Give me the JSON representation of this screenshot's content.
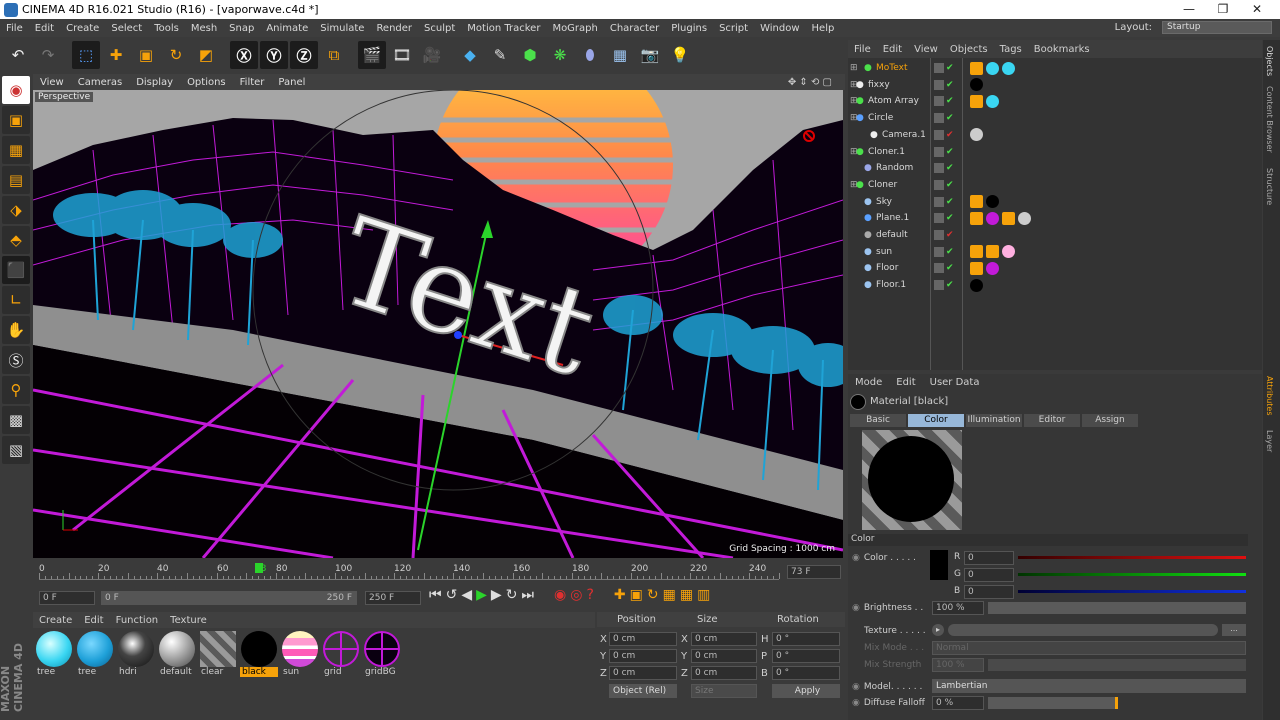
{
  "window": {
    "title": "CINEMA 4D R16.021 Studio (R16) - [vaporwave.c4d *]",
    "minimize": "—",
    "restore": "❐",
    "close": "✕"
  },
  "menu": [
    "File",
    "Edit",
    "Create",
    "Select",
    "Tools",
    "Mesh",
    "Snap",
    "Animate",
    "Simulate",
    "Render",
    "Sculpt",
    "Motion Tracker",
    "MoGraph",
    "Character",
    "Plugins",
    "Script",
    "Window",
    "Help"
  ],
  "layout": {
    "label": "Layout:",
    "value": "Startup"
  },
  "viewport": {
    "menu": [
      "View",
      "Cameras",
      "Display",
      "Options",
      "Filter",
      "Panel"
    ],
    "label": "Perspective",
    "grid": "Grid Spacing : 1000 cm",
    "text3d": "Text"
  },
  "timeline": {
    "ticks": [
      "0",
      "20",
      "40",
      "60",
      "73",
      "80",
      "100",
      "120",
      "140",
      "160",
      "180",
      "200",
      "220",
      "240"
    ],
    "current": "73 F"
  },
  "transport": {
    "start": "0 F",
    "range_start": "0 F",
    "range_end": "250 F",
    "end": "250 F"
  },
  "materials": {
    "menu": [
      "Create",
      "Edit",
      "Function",
      "Texture"
    ],
    "items": [
      "tree",
      "tree",
      "hdri",
      "default",
      "clear",
      "black",
      "sun",
      "grid",
      "gridBG"
    ],
    "brand": "MAXON CINEMA 4D"
  },
  "coords": {
    "headers": [
      "Position",
      "Size",
      "Rotation"
    ],
    "x": "0 cm",
    "y": "0 cm",
    "z": "0 cm",
    "sx": "0 cm",
    "sy": "0 cm",
    "sz": "0 cm",
    "h": "0 °",
    "p": "0 °",
    "b": "0 °",
    "mode": "Object (Rel)",
    "size_mode": "Size",
    "apply": "Apply",
    "lx": "X",
    "ly": "Y",
    "lz": "Z",
    "lh": "H",
    "lp": "P",
    "lb": "B"
  },
  "objects": {
    "menu": [
      "File",
      "Edit",
      "View",
      "Objects",
      "Tags",
      "Bookmarks"
    ],
    "rows": [
      "MoText",
      "fixxy",
      "Atom Array",
      "Circle",
      "Camera.1",
      "Cloner.1",
      "Random",
      "Cloner",
      "Sky",
      "Plane.1",
      "default",
      "sun",
      "Floor",
      "Floor.1"
    ]
  },
  "attributes": {
    "menu": [
      "Mode",
      "Edit",
      "User Data"
    ],
    "material": "Material [black]",
    "tabs": [
      "Basic",
      "Color",
      "Illumination",
      "Editor",
      "Assign"
    ],
    "section": "Color",
    "color_label": "Color . . . . .",
    "r": "0",
    "g": "0",
    "b": "0",
    "rl": "R",
    "gl": "G",
    "bl": "B",
    "brightness_label": "Brightness . .",
    "brightness": "100 %",
    "texture_label": "Texture . . . . .",
    "texture_btn": "...",
    "mixmode_label": "Mix Mode . . .",
    "mixmode": "Normal",
    "mixstrength_label": "Mix Strength",
    "mixstrength": "100 %",
    "model_label": "Model. . . . . .",
    "model": "Lambertian",
    "diffuse_label": "Diffuse Falloff",
    "diffuse": "0 %"
  },
  "side_tabs": [
    "Objects",
    "Content Browser",
    "Structure"
  ],
  "side_tabs2": [
    "Attributes",
    "Layer"
  ]
}
